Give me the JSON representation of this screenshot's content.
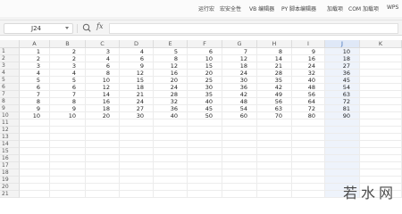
{
  "ribbon": {
    "items": [
      "运行宏",
      "宏安全性",
      "VB 编辑器",
      "PY 脚本编辑器",
      "加载项",
      "COM 加载项",
      "WPS"
    ]
  },
  "formula_bar": {
    "name_box": "J24",
    "fx_label": "fx",
    "formula": ""
  },
  "grid": {
    "columns": [
      "A",
      "B",
      "C",
      "D",
      "E",
      "F",
      "G",
      "H",
      "I",
      "J",
      "K"
    ],
    "active_column": "J",
    "rows": [
      {
        "n": "1",
        "cells": [
          "1",
          "2",
          "3",
          "4",
          "5",
          "6",
          "7",
          "8",
          "9",
          "10"
        ]
      },
      {
        "n": "2",
        "cells": [
          "2",
          "2",
          "4",
          "6",
          "8",
          "10",
          "12",
          "14",
          "16",
          "18"
        ]
      },
      {
        "n": "3",
        "cells": [
          "3",
          "3",
          "6",
          "9",
          "12",
          "15",
          "18",
          "21",
          "24",
          "27"
        ]
      },
      {
        "n": "4",
        "cells": [
          "4",
          "4",
          "8",
          "12",
          "16",
          "20",
          "24",
          "28",
          "32",
          "36"
        ]
      },
      {
        "n": "5",
        "cells": [
          "5",
          "5",
          "10",
          "15",
          "20",
          "25",
          "30",
          "35",
          "40",
          "45"
        ]
      },
      {
        "n": "6",
        "cells": [
          "6",
          "6",
          "12",
          "18",
          "24",
          "30",
          "36",
          "42",
          "48",
          "54"
        ]
      },
      {
        "n": "7",
        "cells": [
          "7",
          "7",
          "14",
          "21",
          "28",
          "35",
          "42",
          "49",
          "56",
          "63"
        ]
      },
      {
        "n": "8",
        "cells": [
          "8",
          "8",
          "16",
          "24",
          "32",
          "40",
          "48",
          "56",
          "64",
          "72"
        ]
      },
      {
        "n": "9",
        "cells": [
          "9",
          "9",
          "18",
          "27",
          "36",
          "45",
          "54",
          "63",
          "72",
          "81"
        ]
      },
      {
        "n": "10",
        "cells": [
          "10",
          "10",
          "20",
          "30",
          "40",
          "50",
          "60",
          "70",
          "80",
          "90"
        ]
      },
      {
        "n": "11",
        "cells": []
      },
      {
        "n": "12",
        "cells": []
      },
      {
        "n": "13",
        "cells": []
      },
      {
        "n": "14",
        "cells": []
      },
      {
        "n": "15",
        "cells": []
      },
      {
        "n": "16",
        "cells": []
      },
      {
        "n": "17",
        "cells": []
      },
      {
        "n": "18",
        "cells": []
      },
      {
        "n": "19",
        "cells": []
      },
      {
        "n": "20",
        "cells": []
      },
      {
        "n": "21",
        "cells": []
      }
    ]
  },
  "watermark": "若水网"
}
